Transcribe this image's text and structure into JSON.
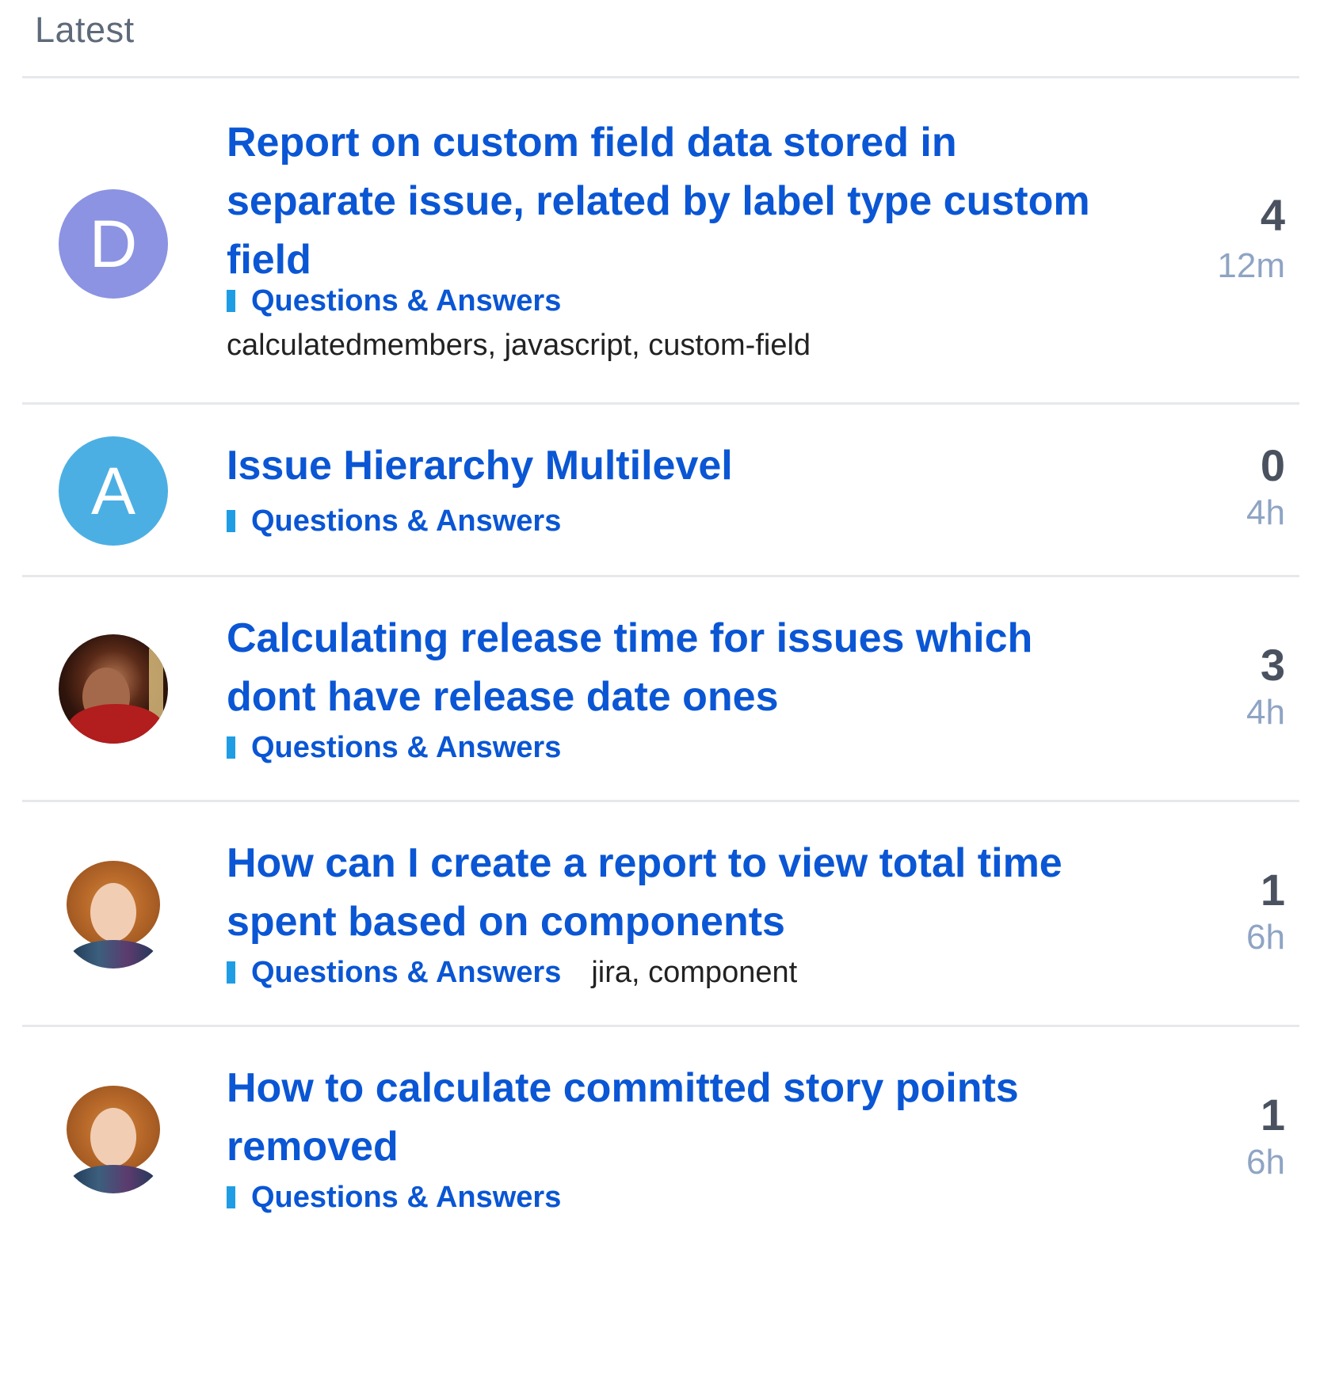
{
  "header": {
    "title": "Latest"
  },
  "topics": [
    {
      "avatar_letter": "D",
      "avatar_color": "#8b93e2",
      "title": "Report on custom field data stored in separate issue, related by label type custom field",
      "category": "Questions & Answers",
      "tags": "calculatedmembers, javascript, custom-field",
      "replies": "4",
      "age": "12m"
    },
    {
      "avatar_letter": "A",
      "avatar_color": "#4cafe3",
      "title": "Issue Hierarchy Multilevel",
      "category": "Questions & Answers",
      "tags": "",
      "replies": "0",
      "age": "4h"
    },
    {
      "avatar_letter": "",
      "avatar_color": "",
      "title": "Calculating release time for issues which dont have release date ones",
      "category": "Questions & Answers",
      "tags": "",
      "replies": "3",
      "age": "4h"
    },
    {
      "avatar_letter": "",
      "avatar_color": "",
      "title": "How can I create a report to view total time spent based on components",
      "category": "Questions & Answers",
      "tags": "jira, component",
      "replies": "1",
      "age": "6h"
    },
    {
      "avatar_letter": "",
      "avatar_color": "",
      "title": "How to calculate committed story points removed",
      "category": "Questions & Answers",
      "tags": "",
      "replies": "1",
      "age": "6h"
    }
  ],
  "colors": {
    "title_blue": "#0a56d4",
    "category_bar": "#1e9de5",
    "age_text": "#8fa4c4",
    "replies_text": "#4a5260",
    "divider": "#e6e8ec"
  }
}
